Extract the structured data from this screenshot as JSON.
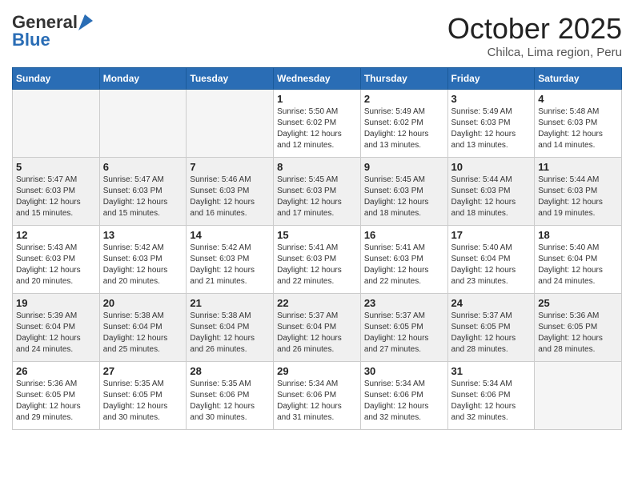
{
  "header": {
    "logo_line1": "General",
    "logo_line2": "Blue",
    "month": "October 2025",
    "location": "Chilca, Lima region, Peru"
  },
  "weekdays": [
    "Sunday",
    "Monday",
    "Tuesday",
    "Wednesday",
    "Thursday",
    "Friday",
    "Saturday"
  ],
  "weeks": [
    [
      {
        "day": "",
        "info": ""
      },
      {
        "day": "",
        "info": ""
      },
      {
        "day": "",
        "info": ""
      },
      {
        "day": "1",
        "info": "Sunrise: 5:50 AM\nSunset: 6:02 PM\nDaylight: 12 hours\nand 12 minutes."
      },
      {
        "day": "2",
        "info": "Sunrise: 5:49 AM\nSunset: 6:02 PM\nDaylight: 12 hours\nand 13 minutes."
      },
      {
        "day": "3",
        "info": "Sunrise: 5:49 AM\nSunset: 6:03 PM\nDaylight: 12 hours\nand 13 minutes."
      },
      {
        "day": "4",
        "info": "Sunrise: 5:48 AM\nSunset: 6:03 PM\nDaylight: 12 hours\nand 14 minutes."
      }
    ],
    [
      {
        "day": "5",
        "info": "Sunrise: 5:47 AM\nSunset: 6:03 PM\nDaylight: 12 hours\nand 15 minutes."
      },
      {
        "day": "6",
        "info": "Sunrise: 5:47 AM\nSunset: 6:03 PM\nDaylight: 12 hours\nand 15 minutes."
      },
      {
        "day": "7",
        "info": "Sunrise: 5:46 AM\nSunset: 6:03 PM\nDaylight: 12 hours\nand 16 minutes."
      },
      {
        "day": "8",
        "info": "Sunrise: 5:45 AM\nSunset: 6:03 PM\nDaylight: 12 hours\nand 17 minutes."
      },
      {
        "day": "9",
        "info": "Sunrise: 5:45 AM\nSunset: 6:03 PM\nDaylight: 12 hours\nand 18 minutes."
      },
      {
        "day": "10",
        "info": "Sunrise: 5:44 AM\nSunset: 6:03 PM\nDaylight: 12 hours\nand 18 minutes."
      },
      {
        "day": "11",
        "info": "Sunrise: 5:44 AM\nSunset: 6:03 PM\nDaylight: 12 hours\nand 19 minutes."
      }
    ],
    [
      {
        "day": "12",
        "info": "Sunrise: 5:43 AM\nSunset: 6:03 PM\nDaylight: 12 hours\nand 20 minutes."
      },
      {
        "day": "13",
        "info": "Sunrise: 5:42 AM\nSunset: 6:03 PM\nDaylight: 12 hours\nand 20 minutes."
      },
      {
        "day": "14",
        "info": "Sunrise: 5:42 AM\nSunset: 6:03 PM\nDaylight: 12 hours\nand 21 minutes."
      },
      {
        "day": "15",
        "info": "Sunrise: 5:41 AM\nSunset: 6:03 PM\nDaylight: 12 hours\nand 22 minutes."
      },
      {
        "day": "16",
        "info": "Sunrise: 5:41 AM\nSunset: 6:03 PM\nDaylight: 12 hours\nand 22 minutes."
      },
      {
        "day": "17",
        "info": "Sunrise: 5:40 AM\nSunset: 6:04 PM\nDaylight: 12 hours\nand 23 minutes."
      },
      {
        "day": "18",
        "info": "Sunrise: 5:40 AM\nSunset: 6:04 PM\nDaylight: 12 hours\nand 24 minutes."
      }
    ],
    [
      {
        "day": "19",
        "info": "Sunrise: 5:39 AM\nSunset: 6:04 PM\nDaylight: 12 hours\nand 24 minutes."
      },
      {
        "day": "20",
        "info": "Sunrise: 5:38 AM\nSunset: 6:04 PM\nDaylight: 12 hours\nand 25 minutes."
      },
      {
        "day": "21",
        "info": "Sunrise: 5:38 AM\nSunset: 6:04 PM\nDaylight: 12 hours\nand 26 minutes."
      },
      {
        "day": "22",
        "info": "Sunrise: 5:37 AM\nSunset: 6:04 PM\nDaylight: 12 hours\nand 26 minutes."
      },
      {
        "day": "23",
        "info": "Sunrise: 5:37 AM\nSunset: 6:05 PM\nDaylight: 12 hours\nand 27 minutes."
      },
      {
        "day": "24",
        "info": "Sunrise: 5:37 AM\nSunset: 6:05 PM\nDaylight: 12 hours\nand 28 minutes."
      },
      {
        "day": "25",
        "info": "Sunrise: 5:36 AM\nSunset: 6:05 PM\nDaylight: 12 hours\nand 28 minutes."
      }
    ],
    [
      {
        "day": "26",
        "info": "Sunrise: 5:36 AM\nSunset: 6:05 PM\nDaylight: 12 hours\nand 29 minutes."
      },
      {
        "day": "27",
        "info": "Sunrise: 5:35 AM\nSunset: 6:05 PM\nDaylight: 12 hours\nand 30 minutes."
      },
      {
        "day": "28",
        "info": "Sunrise: 5:35 AM\nSunset: 6:06 PM\nDaylight: 12 hours\nand 30 minutes."
      },
      {
        "day": "29",
        "info": "Sunrise: 5:34 AM\nSunset: 6:06 PM\nDaylight: 12 hours\nand 31 minutes."
      },
      {
        "day": "30",
        "info": "Sunrise: 5:34 AM\nSunset: 6:06 PM\nDaylight: 12 hours\nand 32 minutes."
      },
      {
        "day": "31",
        "info": "Sunrise: 5:34 AM\nSunset: 6:06 PM\nDaylight: 12 hours\nand 32 minutes."
      },
      {
        "day": "",
        "info": ""
      }
    ]
  ]
}
